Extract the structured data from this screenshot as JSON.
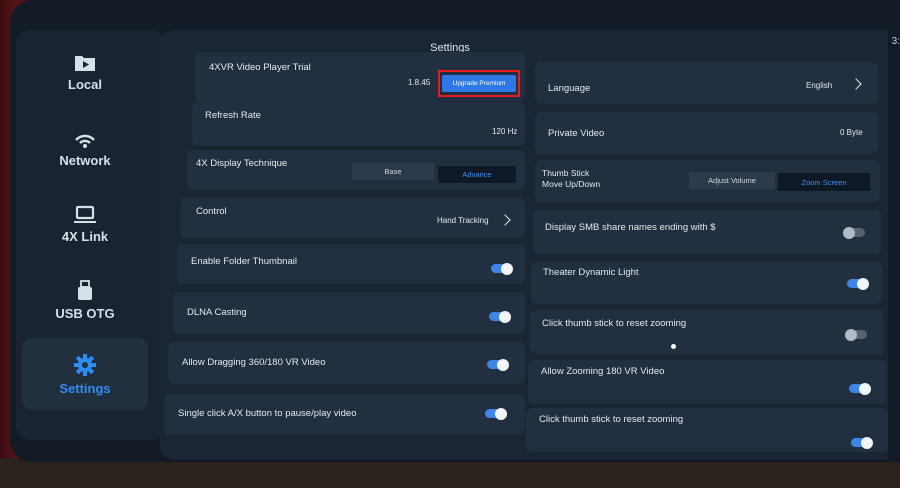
{
  "sidebar": {
    "items": [
      {
        "label": "Local",
        "icon": "video-folder-icon"
      },
      {
        "label": "Network",
        "icon": "wifi-icon"
      },
      {
        "label": "4X Link",
        "icon": "laptop-icon"
      },
      {
        "label": "USB OTG",
        "icon": "usb-drive-icon"
      },
      {
        "label": "Settings",
        "icon": "gear-icon"
      }
    ],
    "active": "Settings"
  },
  "header": {
    "title": "Settings",
    "clock": "3:"
  },
  "left": {
    "trial_label": "4XVR Video Player Trial",
    "version": "1.8.45",
    "upgrade_label": "Upgrade Premium",
    "refresh_label": "Refresh Rate",
    "refresh_value": "120 Hz",
    "display_label": "4X Display Technique",
    "display_options": [
      "Base",
      "Advance"
    ],
    "display_selected": "Advance",
    "control_label": "Control",
    "control_value": "Hand Tracking",
    "folder_thumb_label": "Enable Folder Thumbnail",
    "folder_thumb_on": true,
    "dlna_label": "DLNA Casting",
    "dlna_on": true,
    "drag_label": "Allow Dragging 360/180 VR Video",
    "drag_on": true,
    "single_click_label": "Single click A/X button to pause/play video",
    "single_click_on": true
  },
  "right": {
    "language_label": "Language",
    "language_value": "English",
    "private_label": "Private Video",
    "private_value": "0 Byte",
    "thumb_label_1": "Thumb Stick",
    "thumb_label_2": "Move Up/Down",
    "thumb_options": [
      "Adjust Volume",
      "Zoom Screen"
    ],
    "thumb_selected": "Zoom Screen",
    "smb_label": "Display SMB share names ending with $",
    "smb_on": false,
    "theater_label": "Theater Dynamic Light",
    "theater_on": true,
    "reset_zoom_label": "Click thumb stick to reset zooming",
    "reset_zoom_on": false,
    "zoom180_label": "Allow Zooming 180 VR Video",
    "zoom180_on": true,
    "reset_zoom2_label": "Click thumb stick to reset zooming",
    "reset_zoom2_on": true
  },
  "colors": {
    "accent": "#2f8df6",
    "toggle_on": "#3d86e6",
    "highlight": "#ea1b1b"
  }
}
